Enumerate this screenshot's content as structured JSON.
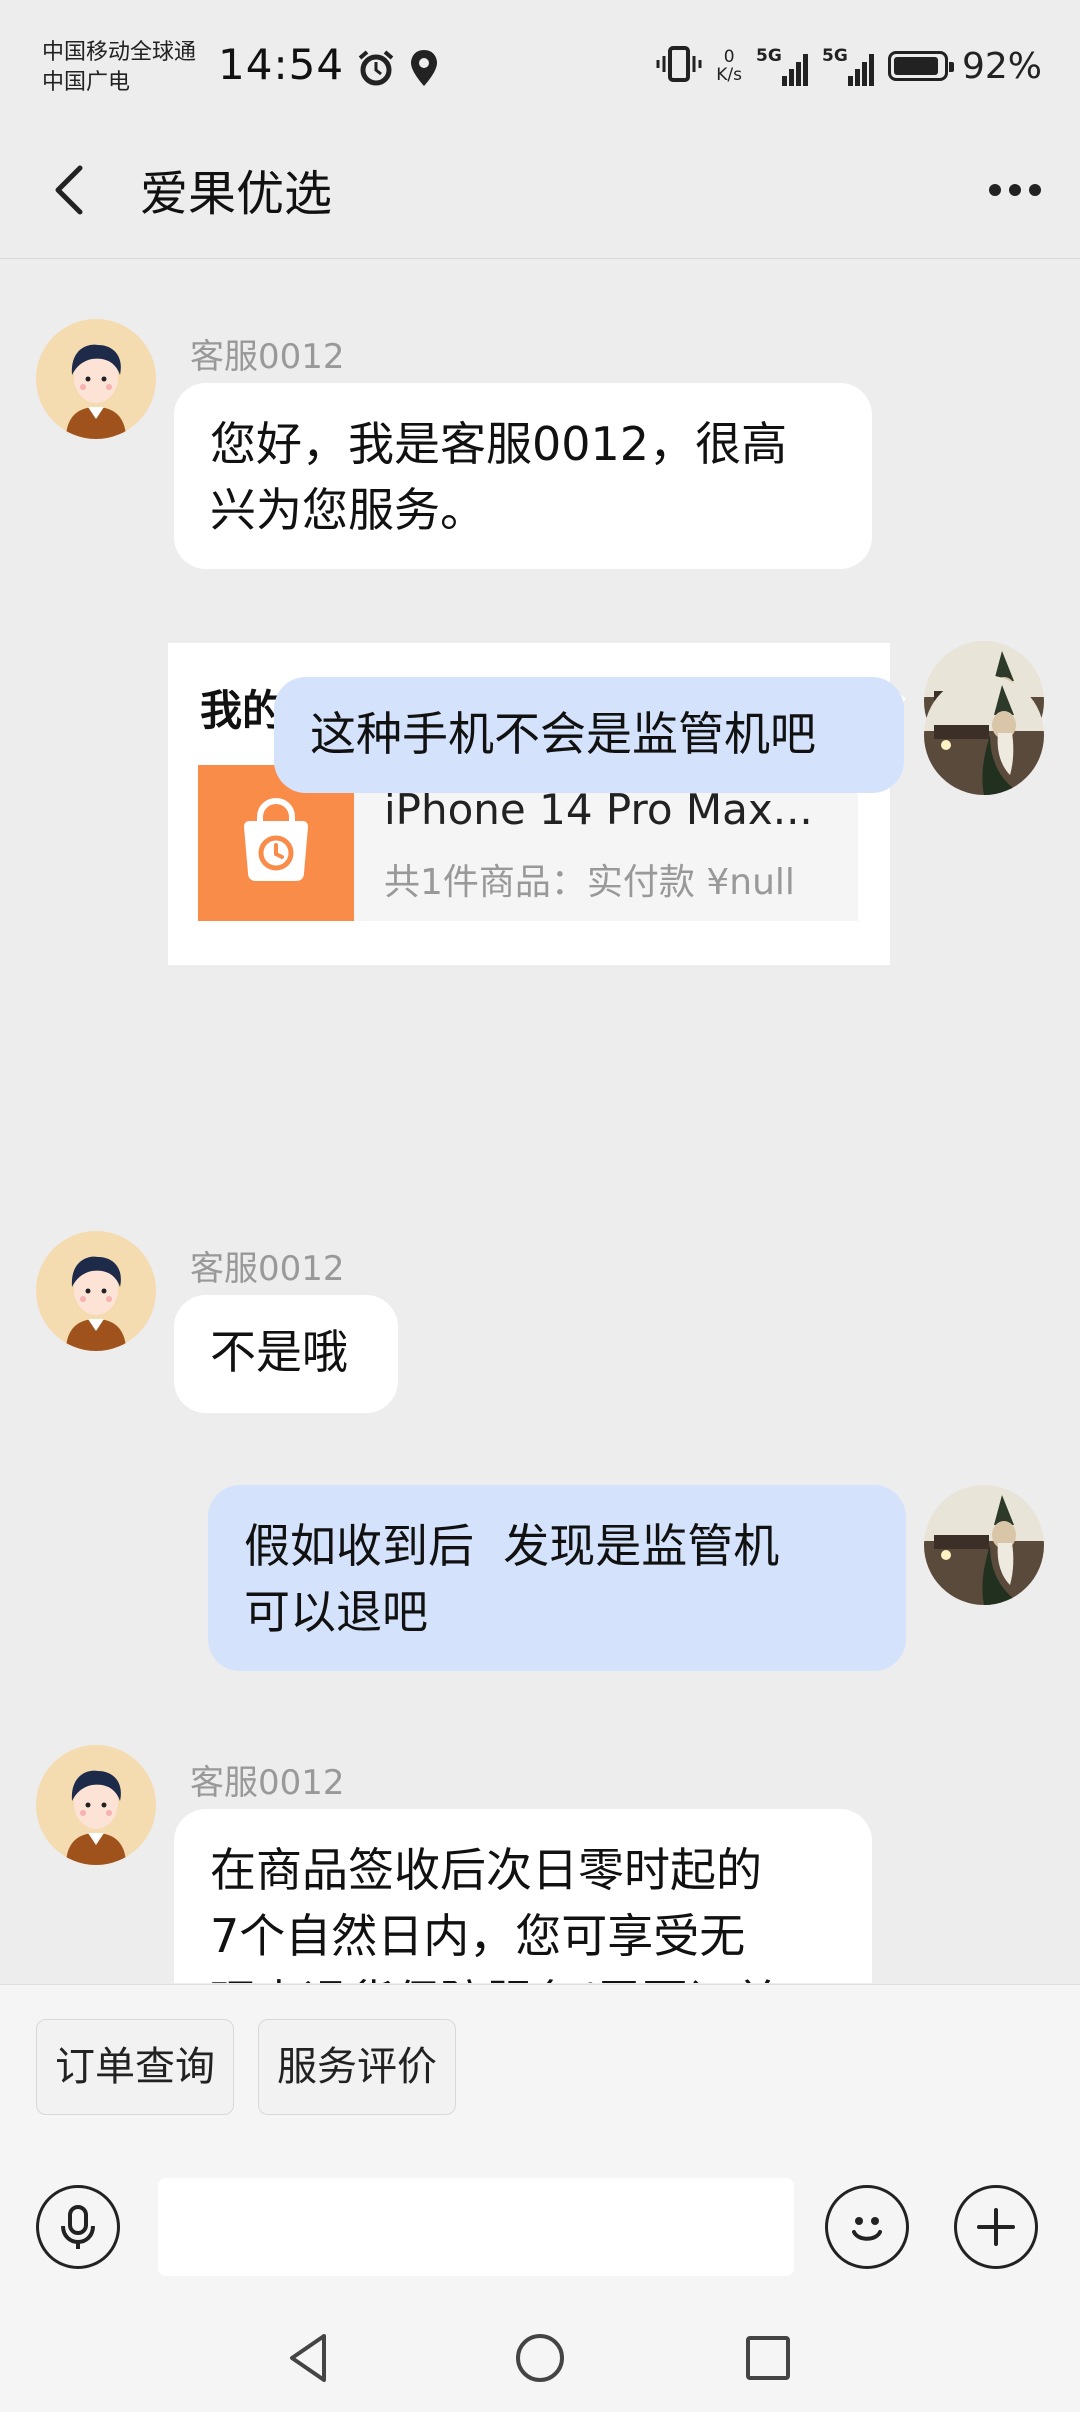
{
  "status_bar": {
    "carrier_1": "中国移动全球通",
    "carrier_2": "中国广电",
    "time": "14:54",
    "net_speed_value": "0",
    "net_speed_unit": "K/s",
    "signal_1_label": "5G",
    "signal_2_label": "5G",
    "battery_level": 0.92,
    "battery_percent": "92%",
    "icons": [
      "alarm-icon",
      "location-icon",
      "vibrate-icon"
    ]
  },
  "header": {
    "title": "爱果优选",
    "back_icon": "chevron-left-icon",
    "more_icon": "more-dots-icon"
  },
  "messages": [
    {
      "side": "in",
      "sender": "客服0012",
      "text_line1": "您好，我是客服0012，很高",
      "text_line2": "兴为您服务。"
    },
    {
      "side": "out",
      "type": "order_card",
      "card_title": "我的订单",
      "item_name": "iPhone 14 Pro Max...",
      "item_summary": "共1件商品：实付款 ¥null"
    },
    {
      "side": "out",
      "text": "这种手机不会是监管机吧"
    },
    {
      "side": "in",
      "sender": "客服0012",
      "text": "不是哦"
    },
    {
      "side": "out",
      "text_line1": "假如收到后  发现是监管机",
      "text_line2": "可以退吧"
    },
    {
      "side": "in",
      "sender": "客服0012",
      "text_line1": "在商品签收后次日零时起的",
      "text_line2": "7个自然日内，您可享受无",
      "text_line3": "理由退货保障服务(需要订单"
    }
  ],
  "quick_actions": [
    "订单查询",
    "服务评价"
  ],
  "input": {
    "placeholder": "",
    "value": ""
  },
  "input_icons": [
    "microphone-icon",
    "emoji-icon",
    "plus-icon"
  ],
  "nav_icons": [
    "nav-back-icon",
    "nav-home-icon",
    "nav-recents-icon"
  ],
  "colors": {
    "background": "#ededed",
    "incoming_bubble": "#ffffff",
    "outgoing_bubble": "#d4e3fb",
    "order_thumb": "#fa8c4a"
  }
}
